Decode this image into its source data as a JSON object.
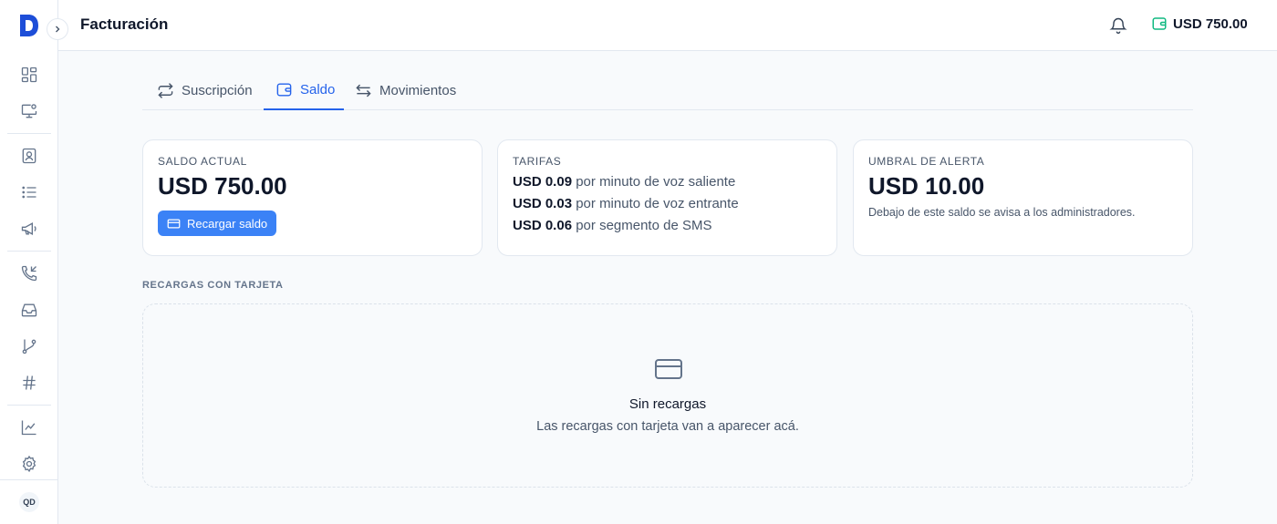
{
  "app": {
    "logo_letter": "D"
  },
  "header": {
    "title": "Facturación",
    "balance": "USD 750.00"
  },
  "sidebar": {
    "items": [
      {
        "name": "dashboard"
      },
      {
        "name": "monitor"
      },
      {
        "name": "contacts"
      },
      {
        "name": "lists"
      },
      {
        "name": "campaigns"
      },
      {
        "name": "calls"
      },
      {
        "name": "inbox"
      },
      {
        "name": "flows"
      },
      {
        "name": "numbers"
      },
      {
        "name": "analytics"
      },
      {
        "name": "settings"
      }
    ],
    "avatar_initials": "QD"
  },
  "tabs": [
    {
      "label": "Suscripción",
      "icon": "repeat-icon",
      "active": false
    },
    {
      "label": "Saldo",
      "icon": "wallet-icon",
      "active": true
    },
    {
      "label": "Movimientos",
      "icon": "arrows-icon",
      "active": false
    }
  ],
  "cards": {
    "balance": {
      "label": "SALDO ACTUAL",
      "amount": "USD 750.00",
      "button": "Recargar saldo"
    },
    "rates": {
      "label": "TARIFAS",
      "lines": [
        {
          "price": "USD 0.09",
          "desc": "por minuto de voz saliente"
        },
        {
          "price": "USD 0.03",
          "desc": "por minuto de voz entrante"
        },
        {
          "price": "USD 0.06",
          "desc": "por segmento de SMS"
        }
      ]
    },
    "alert": {
      "label": "UMBRAL DE ALERTA",
      "amount": "USD 10.00",
      "note": "Debajo de este saldo se avisa a los administradores."
    }
  },
  "topups": {
    "section_label": "RECARGAS CON TARJETA",
    "empty_title": "Sin recargas",
    "empty_sub": "Las recargas con tarjeta van a aparecer acá."
  },
  "colors": {
    "accent": "#2563eb",
    "button": "#3b82f6",
    "wallet": "#10b981",
    "logo": "#1d4ed8"
  }
}
